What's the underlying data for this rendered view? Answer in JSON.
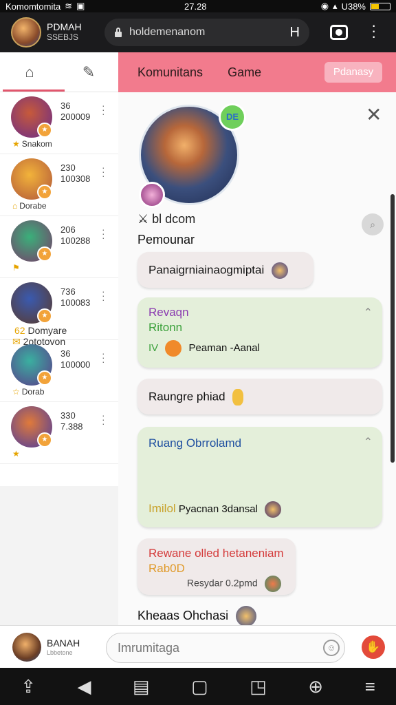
{
  "status": {
    "carrier": "Komomtomita",
    "time": "27.28",
    "battery": "U38%",
    "battery_level": 0.38
  },
  "topbar": {
    "title": "PDMAH",
    "subtitle": "SSEBJS",
    "url": "holdemenanom",
    "url_button": "H"
  },
  "sidebar": {
    "contacts": [
      {
        "line1": "36",
        "line2": "200009",
        "sub": "Snakom",
        "sub_icon": "star-icon",
        "color_a": "#c75a3a",
        "color_b": "#6a2b8a"
      },
      {
        "line1": "230",
        "line2": "100308",
        "sub": "Dorabe",
        "sub_icon": "home-icon",
        "color_a": "#f2b33a",
        "color_b": "#b0553a"
      },
      {
        "line1": "206",
        "line2": "100288",
        "sub": "",
        "sub_icon": "flag-icon",
        "color_a": "#3ab07a",
        "color_b": "#7a3a6a"
      },
      {
        "line1": "736",
        "line2": "100083",
        "sub": "Domyare",
        "sub_prefix": "62",
        "sub2": "2ototovon",
        "sub_icon": "mail-icon",
        "color_a": "#3a5ab0",
        "color_b": "#5a3a2a"
      },
      {
        "line1": "36",
        "line2": "100000",
        "sub": "Dorab",
        "sub_icon": "star-outline-icon",
        "color_a": "#3ab0a0",
        "color_b": "#5a3a8a"
      },
      {
        "line1": "330",
        "line2": "7.388",
        "sub": "",
        "sub_icon": "star-icon",
        "color_a": "#e07a3a",
        "color_b": "#4a3aa0"
      }
    ]
  },
  "main": {
    "tabs": [
      "Komunitans",
      "Game"
    ],
    "action_button": "Pdanasy",
    "hero_tag": "DE",
    "hero_name": "bl dcom",
    "hero_subtitle": "Pemounar",
    "messages": [
      {
        "text": "Panaigrniainaogmiptai"
      },
      {
        "title": "Revaqn",
        "subtitle": "Ritonn",
        "meta_prefix": "IV",
        "meta": "Peaman -Aanal",
        "title_color": "#8a3ab0",
        "subtitle_color": "#3aa03a"
      },
      {
        "text": "Raungre phiad"
      },
      {
        "title": "Ruang Obrrolamd",
        "footer_prefix": "Imilol",
        "footer": "Pyacnan 3dansal",
        "title_color": "#1f4fa0"
      },
      {
        "title": "Rewane olled hetaneniam",
        "subtitle": "Rab0D",
        "footer": "Resydar 0.2pmd",
        "title_color": "#d43a3a",
        "subtitle_color": "#e09a2a"
      }
    ],
    "last_line": "Kheaas Ohchasi"
  },
  "composer": {
    "name": "BANAH",
    "name_sub": "Lbbetone",
    "placeholder": "Imrumitaga"
  },
  "navbar": {
    "icons": [
      "upload-icon",
      "back-icon",
      "inbox-icon",
      "home-icon",
      "edit-icon",
      "search-icon",
      "menu-icon"
    ]
  }
}
